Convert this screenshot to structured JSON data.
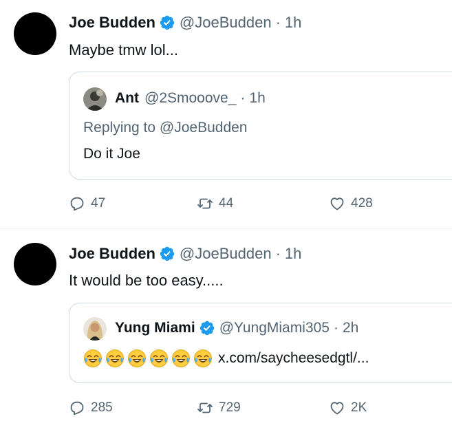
{
  "tweets": [
    {
      "name": "Joe Budden",
      "handle": "@JoeBudden",
      "dot": "·",
      "time": "1h",
      "text": "Maybe tmw lol...",
      "quote": {
        "name": "Ant",
        "handle": "@2Smooove_",
        "dot": "·",
        "time": "1h",
        "reply_prefix": "Replying to ",
        "reply_mention": "@JoeBudden",
        "text": "Do it Joe"
      },
      "stats": {
        "replies": "47",
        "retweets": "44",
        "likes": "428"
      }
    },
    {
      "name": "Joe Budden",
      "handle": "@JoeBudden",
      "dot": "·",
      "time": "1h",
      "text": "It would be too easy.....",
      "quote": {
        "name": "Yung Miami",
        "handle": "@YungMiami305",
        "dot": "·",
        "time": "2h",
        "link": "x.com/saycheesedgtl/..."
      },
      "stats": {
        "replies": "285",
        "retweets": "729",
        "likes": "2K"
      }
    }
  ],
  "colors": {
    "verified": "#1d9bf0",
    "muted": "#536471",
    "border": "#cfd9de",
    "text": "#0f1419"
  },
  "icons": [
    "verified-badge-icon",
    "reply-icon",
    "retweet-icon",
    "like-icon",
    "laughing-emoji-icon"
  ]
}
